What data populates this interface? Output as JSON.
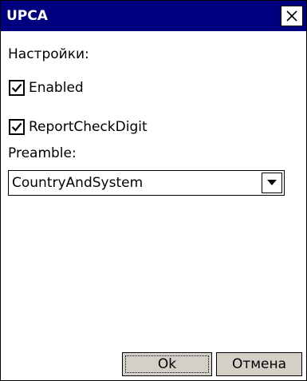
{
  "window": {
    "title": "UPCA",
    "accent_color": "#000080"
  },
  "close_icon": "close-icon",
  "settings_label": "Настройки:",
  "checkboxes": [
    {
      "label": "Enabled",
      "checked": true
    },
    {
      "label": "ReportCheckDigit",
      "checked": true
    }
  ],
  "preamble": {
    "label": "Preamble:",
    "selected": "CountryAndSystem"
  },
  "buttons": {
    "ok_label": "Ok",
    "cancel_label": "Отмена",
    "face_color": "#d4d0c8"
  }
}
